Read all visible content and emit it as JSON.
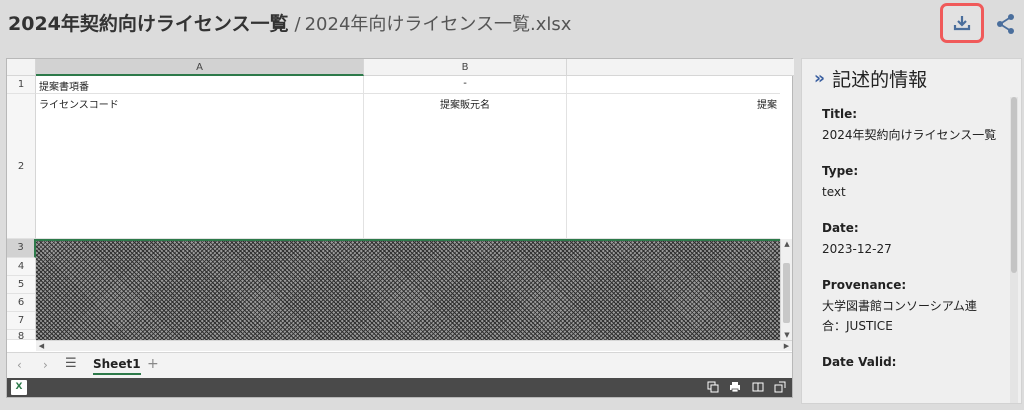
{
  "header": {
    "title": "2024年契約向けライセンス一覧",
    "separator": "/",
    "filename": "2024年向けライセンス一覧.xlsx",
    "download_icon": "download-icon",
    "share_icon": "share-icon",
    "accent_color": "#f05a5a"
  },
  "spreadsheet": {
    "columns": [
      "A",
      "B"
    ],
    "rows": [
      "1",
      "2",
      "3",
      "4",
      "5",
      "6",
      "7",
      "8"
    ],
    "cells": {
      "a1": "提案書項番",
      "b1": "-",
      "a2": "ライセンスコード",
      "b2": "提案販元名",
      "c2": "提案"
    },
    "sheet_tab": "Sheet1",
    "add_sheet": "+",
    "menu_icon": "☰",
    "excel_logo": "X",
    "selection_color": "#2d7a4a"
  },
  "panel": {
    "heading": "記述的情報",
    "toggle_icon": "chevron-double-right-icon",
    "fields": [
      {
        "label": "Title:",
        "value": "2024年契約向けライセンス一覧"
      },
      {
        "label": "Type:",
        "value": "text"
      },
      {
        "label": "Date:",
        "value": "2023-12-27"
      },
      {
        "label": "Provenance:",
        "value": "大学図書館コンソーシアム連合：JUSTICE"
      },
      {
        "label": "Date Valid:",
        "value": ""
      }
    ]
  }
}
